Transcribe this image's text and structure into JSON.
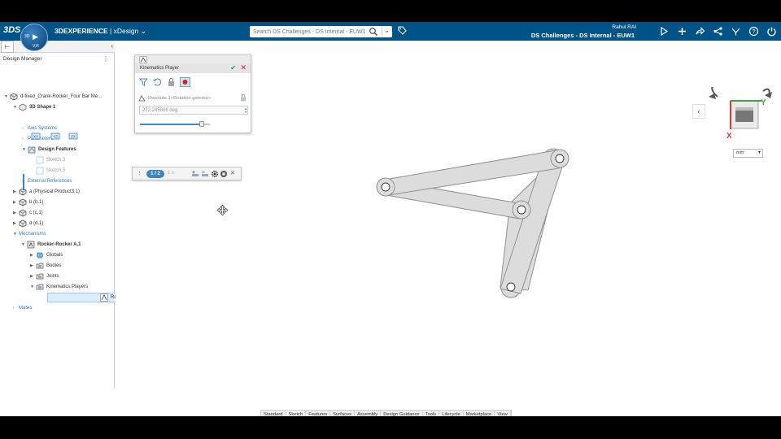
{
  "topbar": {
    "logo": "3DS",
    "compass": {
      "left": "3D",
      "center": "▶",
      "bottom": "V,R"
    },
    "brand_strong": "3DEXPERIENCE",
    "brand_app": " | xDesign",
    "brand_chevron": "⌄",
    "search_placeholder": "Search DS Challenges - DS Internal - EUW1",
    "user_name": "Rahul RAI",
    "tenant": "DS Challenges - DS Internal - EUW1",
    "icons": [
      "cube-icon",
      "plus-icon",
      "share-icon",
      "network-icon",
      "compass-apps-icon",
      "help-icon",
      "power-icon"
    ]
  },
  "tree": {
    "header": "Design Manager",
    "menu": "⋮",
    "rows": [
      {
        "label": "d-fixed_Crank-Rocker_Four Bar Me...",
        "style": "",
        "icon": "part"
      },
      {
        "label": "3D Shape 1",
        "style": "bold",
        "icon": "shape"
      },
      {
        "label": "Axis Systems",
        "style": "link",
        "icon": ""
      },
      {
        "label": "Parameters",
        "style": "link",
        "icon": ""
      },
      {
        "label": "Design Features",
        "style": "bold",
        "icon": "features"
      },
      {
        "label": "Sketch.3",
        "style": "grey",
        "icon": "sketch"
      },
      {
        "label": "Sketch.5",
        "style": "grey",
        "icon": "sketch"
      },
      {
        "label": "External References",
        "style": "link",
        "icon": ""
      },
      {
        "label": "a (Physical Product3.1)",
        "style": "",
        "icon": "part"
      },
      {
        "label": "b (b.1)",
        "style": "",
        "icon": "part"
      },
      {
        "label": "c (c.1)",
        "style": "",
        "icon": "part"
      },
      {
        "label": "d (d.1)",
        "style": "",
        "icon": "part"
      },
      {
        "label": "Mechanisms",
        "style": "link",
        "icon": ""
      },
      {
        "label": "Rocker-Rocker A.1",
        "style": "bold",
        "icon": "mechanism"
      },
      {
        "label": "Globals",
        "style": "",
        "icon": "globe"
      },
      {
        "label": "Bodies",
        "style": "",
        "icon": "folder"
      },
      {
        "label": "Joints",
        "style": "",
        "icon": "folder"
      },
      {
        "label": "Kinematics Players",
        "style": "",
        "icon": "folder"
      },
      {
        "label": "Rocker-Rocker",
        "style": "",
        "icon": "player"
      },
      {
        "label": "Mates",
        "style": "link",
        "icon": ""
      }
    ],
    "shape_sub_icons": [
      "XY",
      "YZ",
      "ZX"
    ]
  },
  "kinematics_player": {
    "title": "Kinematics Player",
    "ok": "✔",
    "close": "✕",
    "joint": "Revolute.1<Rotation gamma>",
    "value": "272.245806 deg",
    "slider_fraction": 0.88
  },
  "step_bar": {
    "grip": "⋮",
    "count": "1 / 2",
    "time": "1 s",
    "close": "✕"
  },
  "view": {
    "back": "‹",
    "axis_y": "Y",
    "axis_x": "X",
    "units": "mm",
    "units_caret": "▾"
  },
  "action_tabs": [
    "Standard",
    "Sketch",
    "Features",
    "Surfaces",
    "Assembly",
    "Design Guidance",
    "Tools",
    "Lifecycle",
    "Marketplace",
    "View"
  ],
  "active_tab": "Sketch",
  "colors": {
    "topbar": "#005386",
    "link": "#2b7bc0",
    "selection": "#dceefb",
    "link_part": "#dcdcdc",
    "link_stroke": "#8f8f8f",
    "axis_x": "#e53935",
    "axis_y": "#43a047"
  }
}
